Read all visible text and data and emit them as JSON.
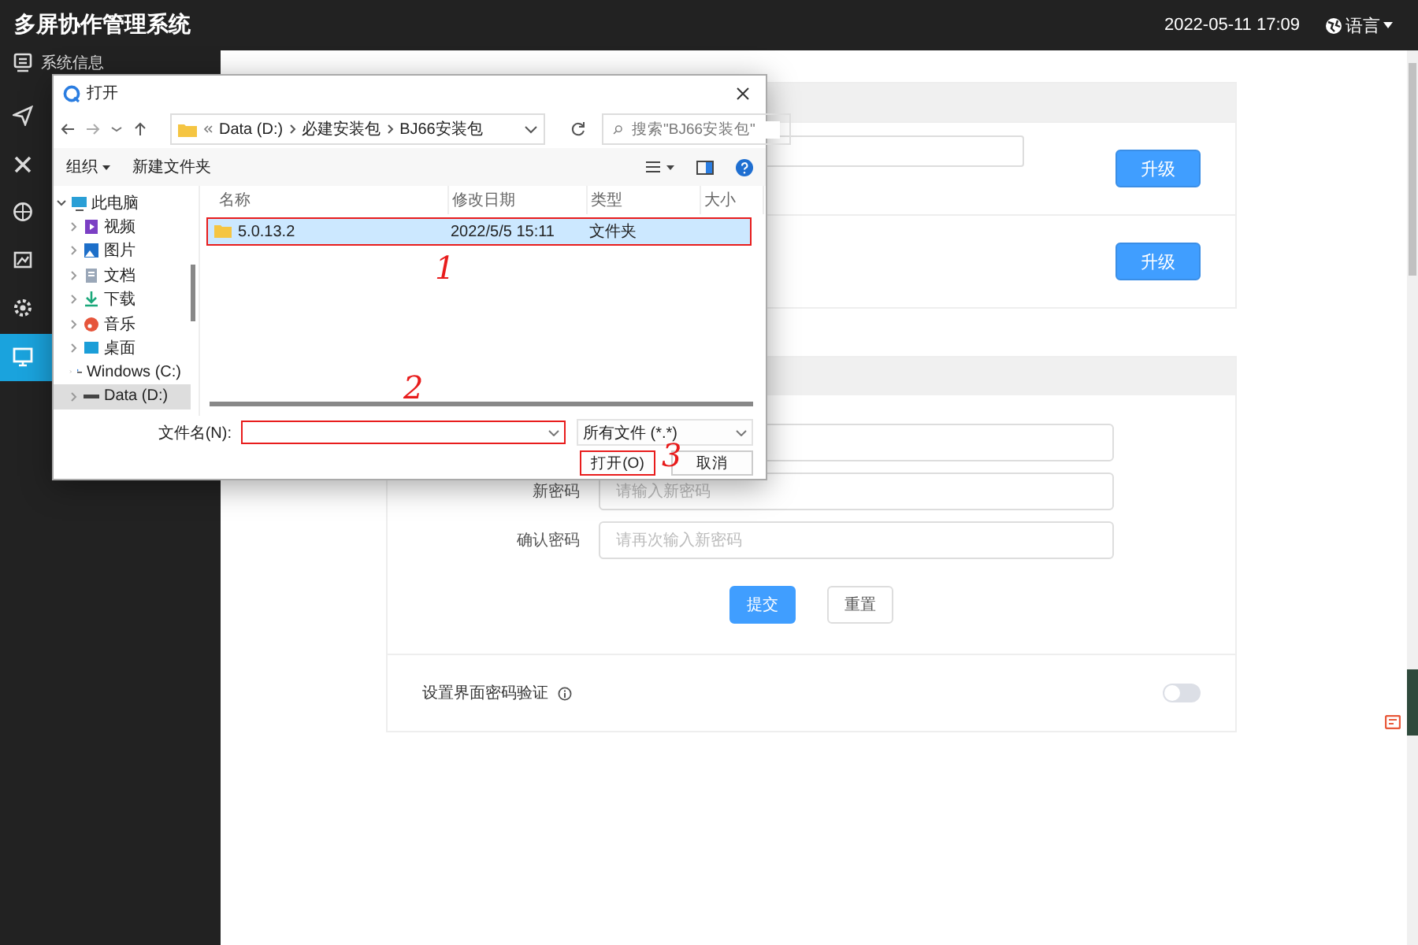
{
  "header": {
    "title": "多屏协作管理系统",
    "datetime": "2022-05-11 17:09",
    "language": "语言"
  },
  "sidebar": {
    "items": [
      {
        "label": "系统信息",
        "selected": false
      },
      {
        "selected": false
      },
      {
        "selected": false
      },
      {
        "selected": false
      },
      {
        "selected": false
      },
      {
        "selected": false
      },
      {
        "selected": true
      }
    ]
  },
  "upgrade_card": {
    "rows": [
      {
        "kind": "file",
        "button": "升级"
      },
      {
        "kind": "plain",
        "button": "升级"
      }
    ]
  },
  "password_card": {
    "fields": [
      {
        "kind": "covered"
      },
      {
        "kind": "field",
        "label": "新密码",
        "placeholder": "请输入新密码"
      },
      {
        "kind": "field",
        "label": "确认密码",
        "placeholder": "请再次输入新密码"
      }
    ],
    "buttons": [
      {
        "label": "提交",
        "kind": "primary"
      },
      {
        "label": "重置",
        "kind": "plain"
      }
    ],
    "toggle": {
      "label": "设置界面密码验证",
      "on": false
    }
  },
  "dialog": {
    "title": "打开",
    "breadcrumbs": [
      "Data (D:)",
      "必建安装包",
      "BJ66安装包"
    ],
    "search": {
      "placeholder": "搜索\"BJ66安装包\""
    },
    "toolbar": [
      "组织",
      "新建文件夹"
    ],
    "tree": [
      {
        "label": "此电脑",
        "expanded": true,
        "selected": false,
        "children": [
          {
            "label": "视频",
            "selected": false
          },
          {
            "label": "图片",
            "selected": false
          },
          {
            "label": "文档",
            "selected": false
          },
          {
            "label": "下载",
            "selected": false
          },
          {
            "label": "音乐",
            "selected": false
          },
          {
            "label": "桌面",
            "selected": false
          },
          {
            "label": "Windows (C:)",
            "selected": false
          },
          {
            "label": "Data (D:)",
            "selected": true
          }
        ]
      }
    ],
    "columns": [
      "名称",
      "修改日期",
      "类型",
      "大小"
    ],
    "rows": [
      {
        "name": "5.0.13.2",
        "date": "2022/5/5 15:11",
        "type": "文件夹",
        "selected": true
      }
    ],
    "filename_label": "文件名(N):",
    "filter": "所有文件 (*.*)",
    "buttons": [
      "打开(O)",
      "取消"
    ]
  },
  "annotations": [
    {
      "text": "1"
    },
    {
      "text": "2"
    },
    {
      "text": "3"
    }
  ]
}
